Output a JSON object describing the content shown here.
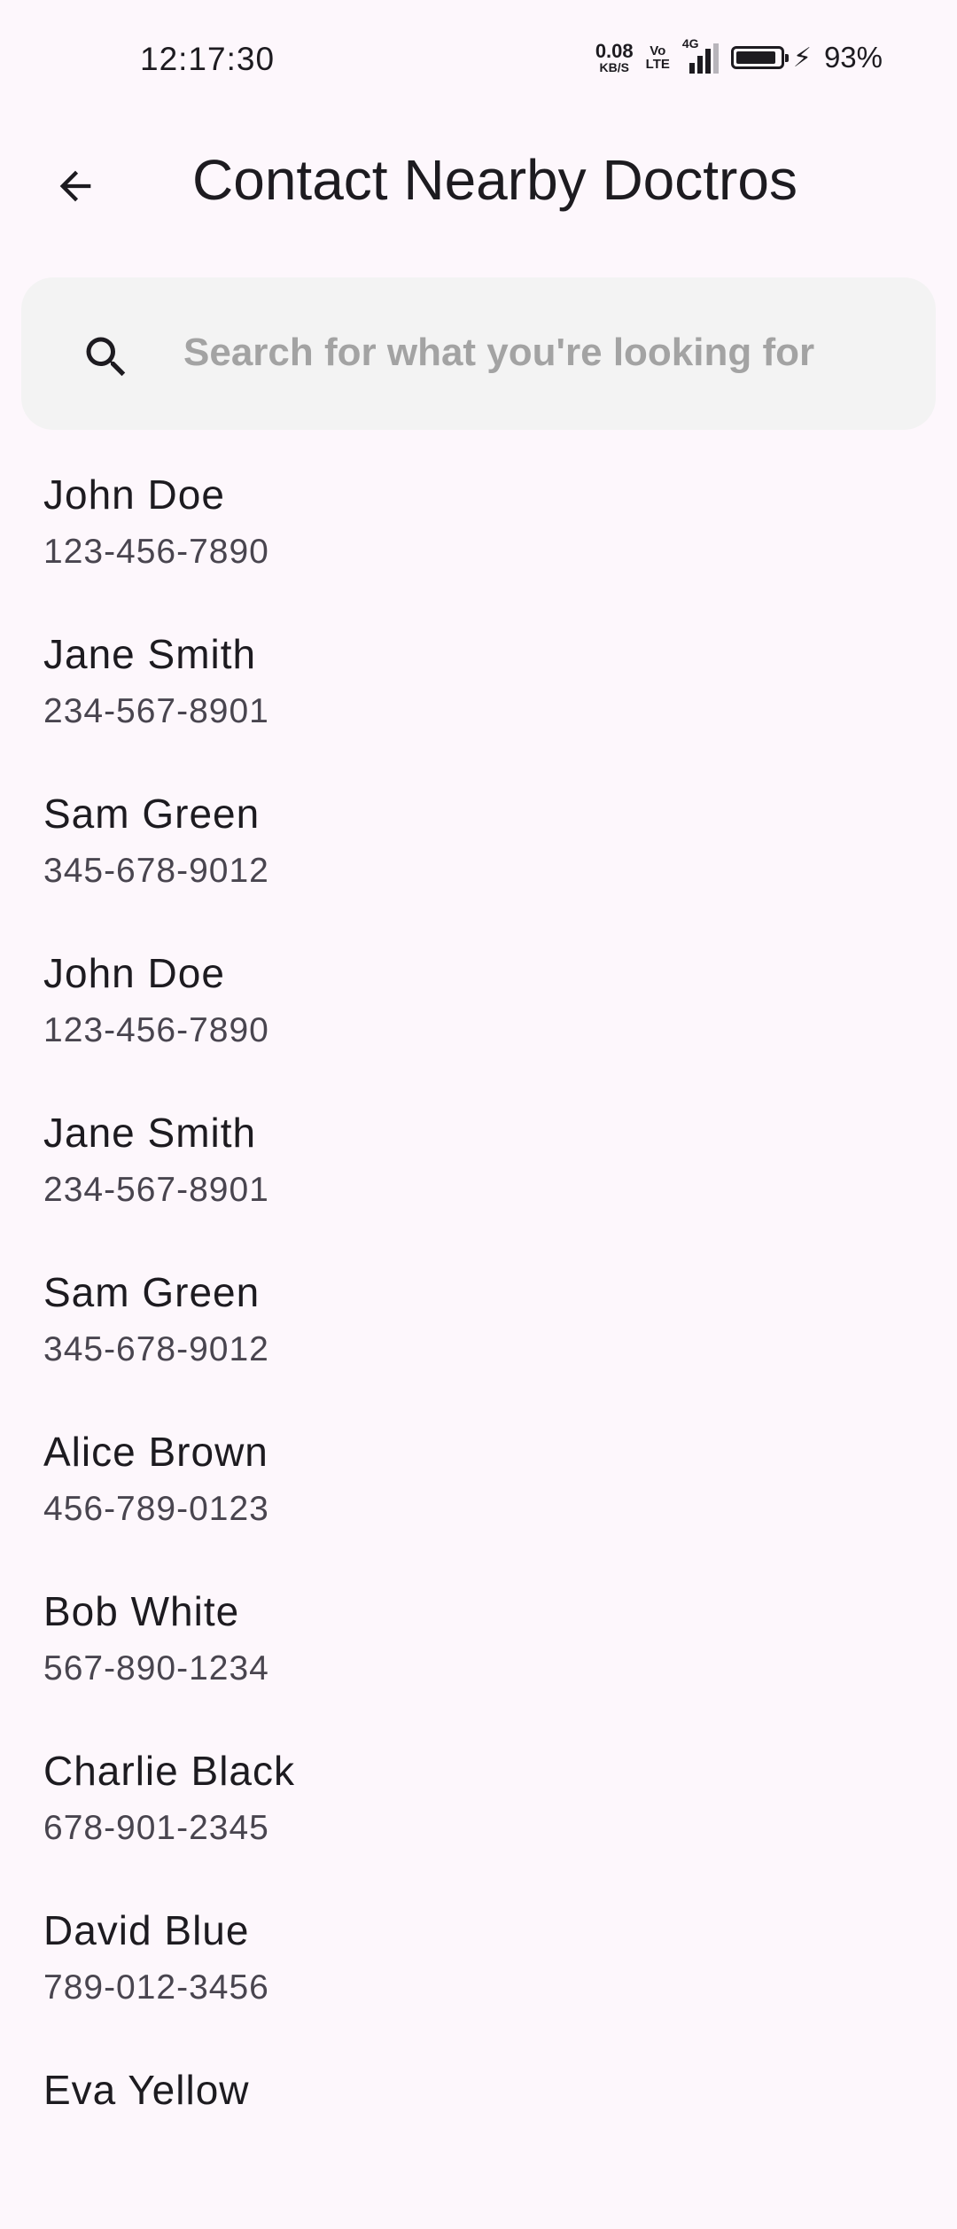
{
  "status_bar": {
    "time": "12:17:30",
    "net_speed_value": "0.08",
    "net_speed_unit": "KB/S",
    "volte_top": "Vo",
    "volte_bottom": "LTE",
    "network": "4G",
    "battery_percent": "93%",
    "battery_level": 0.93,
    "charging": true
  },
  "app_bar": {
    "back_icon": "arrow-back-icon",
    "title": "Contact Nearby Doctros"
  },
  "search": {
    "icon": "search-icon",
    "placeholder": "Search for what you're looking for",
    "value": ""
  },
  "contacts": [
    {
      "name": "John Doe",
      "phone": "123-456-7890"
    },
    {
      "name": "Jane Smith",
      "phone": "234-567-8901"
    },
    {
      "name": "Sam Green",
      "phone": "345-678-9012"
    },
    {
      "name": "John Doe",
      "phone": "123-456-7890"
    },
    {
      "name": "Jane Smith",
      "phone": "234-567-8901"
    },
    {
      "name": "Sam Green",
      "phone": "345-678-9012"
    },
    {
      "name": "Alice Brown",
      "phone": "456-789-0123"
    },
    {
      "name": "Bob White",
      "phone": "567-890-1234"
    },
    {
      "name": "Charlie Black",
      "phone": "678-901-2345"
    },
    {
      "name": "David Blue",
      "phone": "789-012-3456"
    },
    {
      "name": "Eva Yellow",
      "phone": ""
    }
  ],
  "colors": {
    "background": "#fdf7fc",
    "search_background": "#f3f3f3",
    "primary_text": "#1d1b20",
    "secondary_text": "#49454f",
    "placeholder_text": "#a3a3a3"
  }
}
